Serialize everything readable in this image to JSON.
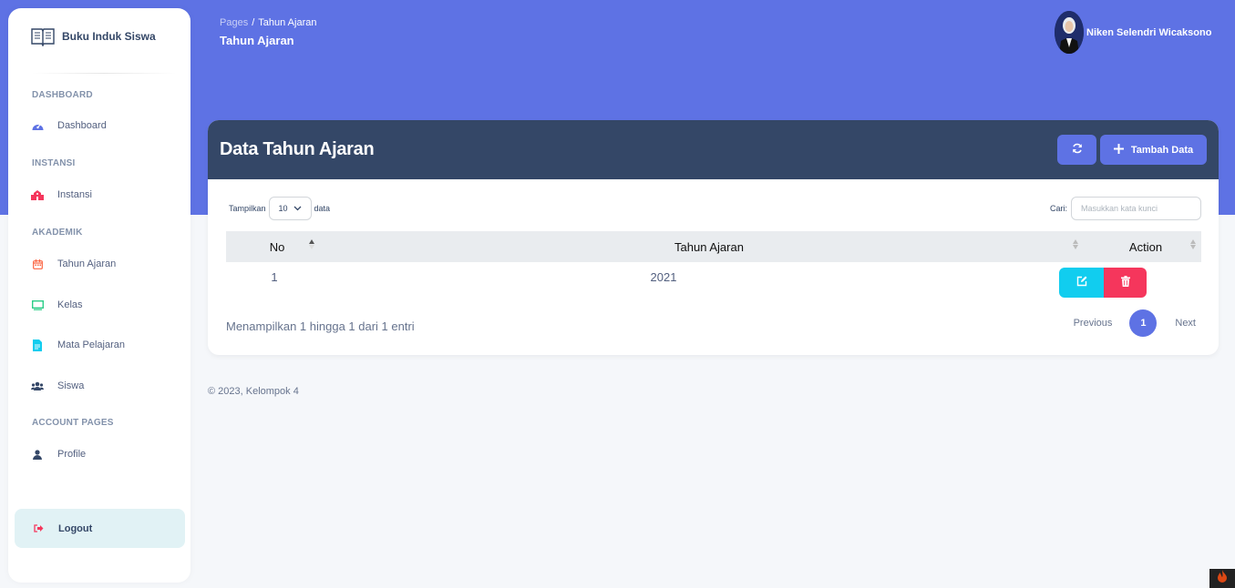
{
  "app": {
    "name": "Buku Induk Siswa"
  },
  "sidebar": {
    "sections": [
      {
        "title": "DASHBOARD",
        "items": [
          {
            "label": "Dashboard",
            "icon": "palette-icon",
            "color": "#5e72e4"
          }
        ]
      },
      {
        "title": "INSTANSI",
        "items": [
          {
            "label": "Instansi",
            "icon": "school-icon",
            "color": "#f5365c"
          }
        ]
      },
      {
        "title": "AKADEMIK",
        "items": [
          {
            "label": "Tahun Ajaran",
            "icon": "calendar-icon",
            "color": "#fb6340"
          },
          {
            "label": "Kelas",
            "icon": "monitor-icon",
            "color": "#2dce89"
          },
          {
            "label": "Mata Pelajaran",
            "icon": "document-icon",
            "color": "#11cdef"
          },
          {
            "label": "Siswa",
            "icon": "users-icon",
            "color": "#344767"
          }
        ]
      },
      {
        "title": "ACCOUNT PAGES",
        "items": [
          {
            "label": "Profile",
            "icon": "user-icon",
            "color": "#344767"
          }
        ]
      }
    ],
    "logout": {
      "label": "Logout",
      "icon": "logout-icon",
      "color": "#f5365c"
    }
  },
  "breadcrumb": {
    "root": "Pages",
    "separator": "/",
    "current": "Tahun Ajaran"
  },
  "page_title": "Tahun Ajaran",
  "user": {
    "name": "Niken Selendri Wicaksono"
  },
  "card": {
    "title": "Data Tahun Ajaran",
    "refresh_icon": "refresh-icon",
    "add_label": "Tambah Data",
    "add_icon": "plus-icon"
  },
  "table_controls": {
    "length_prefix": "Tampilkan",
    "length_value": "10",
    "length_suffix": "data",
    "search_label": "Cari:",
    "search_placeholder": "Masukkan kata kunci",
    "search_value": ""
  },
  "table": {
    "columns": [
      "No",
      "Tahun Ajaran",
      "Action"
    ],
    "rows": [
      {
        "no": "1",
        "tahun_ajaran": "2021"
      }
    ]
  },
  "table_info": "Menampilkan 1 hingga 1 dari 1 entri",
  "pagination": {
    "previous": "Previous",
    "current": "1",
    "next": "Next"
  },
  "footer": {
    "text": "© 2023, Kelompok 4"
  },
  "colors": {
    "primary": "#5e72e4",
    "dark": "#344767",
    "info": "#11cdef",
    "danger": "#f5365c",
    "page_bg": "#f5f7fa"
  }
}
